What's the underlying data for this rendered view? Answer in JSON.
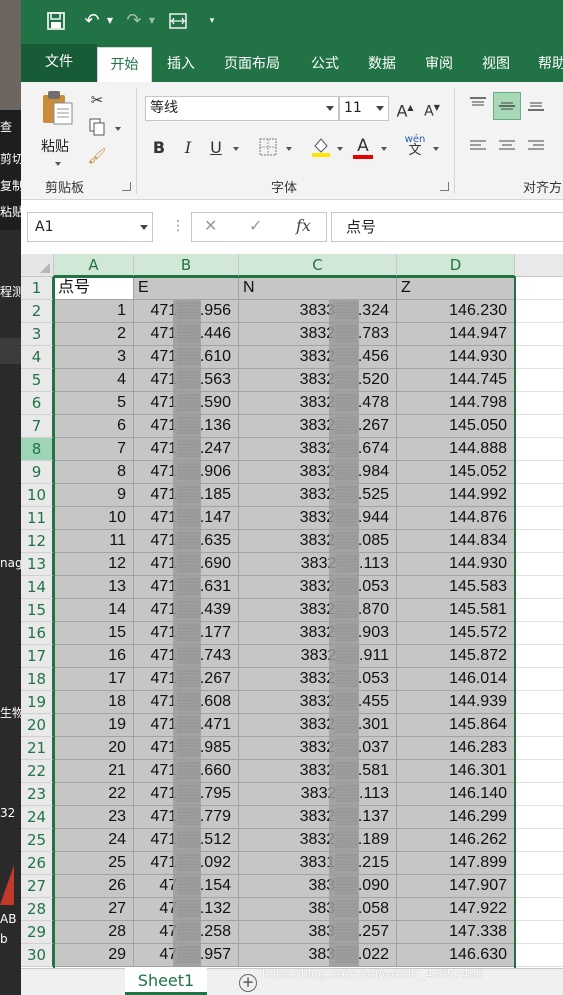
{
  "background_window": {
    "left_labels": [
      "剪切",
      "复制",
      "粘贴",
      "程测",
      "nag",
      "生物",
      "32",
      "AB",
      "b"
    ],
    "header_char": "查"
  },
  "qat": {
    "save_icon": "save-icon",
    "undo_icon": "undo-icon",
    "redo_icon": "redo-icon",
    "customize_icon": "customize-qat-icon"
  },
  "tabs": [
    "文件",
    "开始",
    "插入",
    "页面布局",
    "公式",
    "数据",
    "审阅",
    "视图",
    "帮助"
  ],
  "active_tab": "开始",
  "ribbon": {
    "paste_label": "粘贴",
    "clipboard_group": "剪贴板",
    "font_group": "字体",
    "align_group": "对齐方",
    "font_name": "等线",
    "font_size": "11",
    "grow_font": "A",
    "shrink_font": "A",
    "bold": "B",
    "italic": "I",
    "underline": "U",
    "font_color_letter": "A",
    "wen_label": "wén\n文"
  },
  "formula_bar": {
    "name_box": "A1",
    "cancel": "✕",
    "enter": "✓",
    "fx": "fx",
    "content": "点号"
  },
  "sheet": {
    "columns": [
      "A",
      "B",
      "C",
      "D"
    ],
    "header_row": [
      "点号",
      "E",
      "N",
      "Z"
    ],
    "rows": [
      [
        "1",
        "471▒▒.956",
        "3833▒▒.324",
        "146.230"
      ],
      [
        "2",
        "471▒▒.446",
        "3832▒▒.783",
        "144.947"
      ],
      [
        "3",
        "471▒▒.610",
        "3832▒▒.456",
        "144.930"
      ],
      [
        "4",
        "471▒▒.563",
        "3832▒▒.520",
        "144.745"
      ],
      [
        "5",
        "471▒▒.590",
        "3832▒▒.478",
        "144.798"
      ],
      [
        "6",
        "471▒▒.136",
        "3832▒▒.267",
        "145.050"
      ],
      [
        "7",
        "471▒▒.247",
        "3832▒▒.674",
        "144.888"
      ],
      [
        "8",
        "471▒▒.906",
        "3832▒▒.984",
        "145.052"
      ],
      [
        "9",
        "471▒▒.185",
        "3832▒▒.525",
        "144.992"
      ],
      [
        "10",
        "471▒▒.147",
        "3832▒▒.944",
        "144.876"
      ],
      [
        "11",
        "471▒▒.635",
        "3832▒▒.085",
        "144.834"
      ],
      [
        "12",
        "471▒▒.690",
        "3832▒▒.113",
        "144.930"
      ],
      [
        "13",
        "471▒▒.631",
        "3832▒▒.053",
        "145.583"
      ],
      [
        "14",
        "471▒▒.439",
        "3832▒▒.870",
        "145.581"
      ],
      [
        "15",
        "471▒▒.177",
        "3832▒▒.903",
        "145.572"
      ],
      [
        "16",
        "471▒▒.743",
        "3832▒▒.911",
        "145.872"
      ],
      [
        "17",
        "471▒▒.267",
        "3832▒▒.053",
        "146.014"
      ],
      [
        "18",
        "471▒▒.608",
        "3832▒▒.455",
        "144.939"
      ],
      [
        "19",
        "471▒▒.471",
        "3832▒▒.301",
        "145.864"
      ],
      [
        "20",
        "471▒▒.985",
        "3832▒▒.037",
        "146.283"
      ],
      [
        "21",
        "471▒▒.660",
        "3832▒▒.581",
        "146.301"
      ],
      [
        "22",
        "471▒▒.795",
        "3832▒▒.113",
        "146.140"
      ],
      [
        "23",
        "471▒▒.779",
        "3832▒▒.137",
        "146.299"
      ],
      [
        "24",
        "471▒▒.512",
        "3832▒▒.189",
        "146.262"
      ],
      [
        "25",
        "471▒▒.092",
        "3831▒▒.215",
        "147.899"
      ],
      [
        "26",
        "47▒▒.154",
        "383▒▒.090",
        "147.907"
      ],
      [
        "27",
        "47▒▒.132",
        "383▒▒.058",
        "147.922"
      ],
      [
        "28",
        "47▒▒.258",
        "383▒▒.257",
        "147.338"
      ],
      [
        "29",
        "47▒▒.957",
        "383▒▒.022",
        "146.630"
      ]
    ],
    "row_numbers": [
      "1",
      "2",
      "3",
      "4",
      "5",
      "6",
      "7",
      "8",
      "9",
      "10",
      "11",
      "12",
      "13",
      "14",
      "15",
      "16",
      "17",
      "18",
      "19",
      "20",
      "21",
      "22",
      "23",
      "24",
      "25",
      "26",
      "27",
      "28",
      "29",
      "30"
    ],
    "active_row": "8"
  },
  "sheet_tabs": {
    "active": "Sheet1",
    "add": "+"
  },
  "watermark": "https://blog.csdn.net/weixin_43657490",
  "colors": {
    "excel_green": "#217346",
    "selection_fill": "#c6c6c6"
  }
}
